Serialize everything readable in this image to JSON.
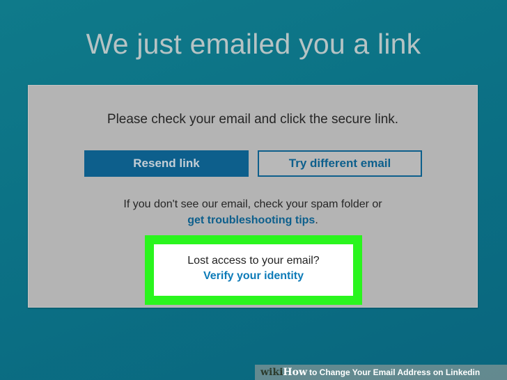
{
  "page": {
    "heading": "We just emailed you a link"
  },
  "card": {
    "instruction": "Please check your email and click the secure link.",
    "resend_label": "Resend link",
    "try_different_label": "Try different email",
    "spam_text": "If you don't see our email, check your spam folder or",
    "tips_link": "get troubleshooting tips",
    "tips_period": "."
  },
  "lost_access": {
    "question": "Lost access to your email?",
    "verify_link": "Verify your identity"
  },
  "watermark": {
    "logo_wiki": "wiki",
    "logo_how": "How",
    "title": "to Change Your Email Address on Linkedin"
  },
  "colors": {
    "background": "#0b6f84",
    "primary_button": "#0d5f8c",
    "highlight_border": "#2af51e",
    "link": "#0d7bb8"
  }
}
